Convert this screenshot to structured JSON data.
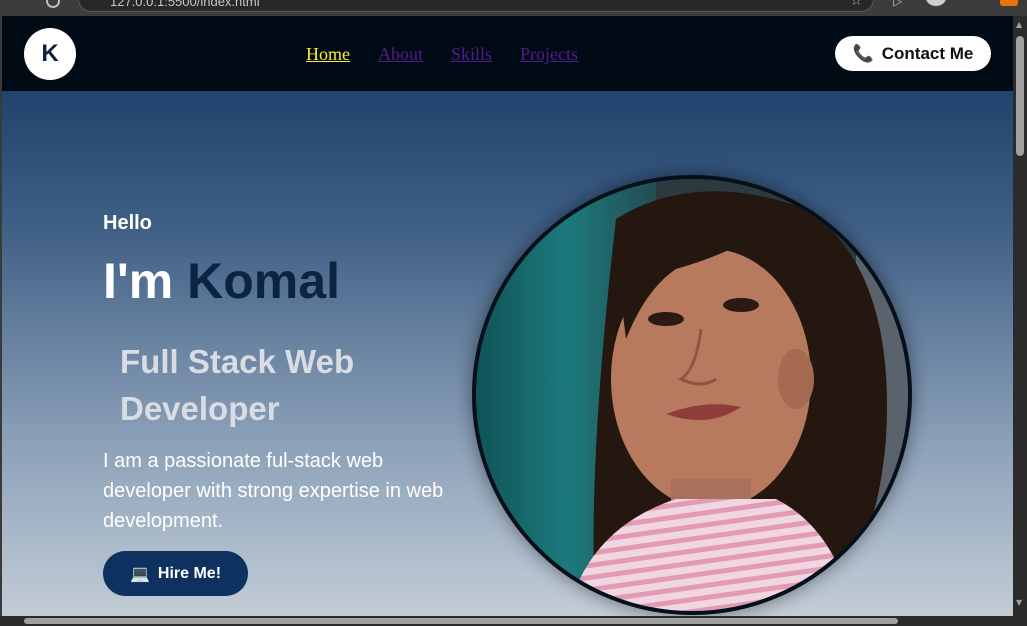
{
  "browser": {
    "url_text": "127.0.0.1:5500/index.html"
  },
  "navbar": {
    "logo_letter": "K",
    "links": [
      {
        "label": "Home",
        "active": true
      },
      {
        "label": "About",
        "active": false
      },
      {
        "label": "Skills",
        "active": false
      },
      {
        "label": "Projects",
        "active": false
      }
    ],
    "contact_label": "Contact Me",
    "contact_icon": "phone-icon"
  },
  "hero": {
    "greeting": "Hello",
    "intro_prefix": "I'm",
    "name": "Komal",
    "role": "Full Stack Web Developer",
    "description": "I am a passionate ful-stack web developer with strong expertise in web development.",
    "hire_label": "Hire Me!",
    "hire_icon": "laptop-icon"
  },
  "colors": {
    "nav_bg": "#010b16",
    "active_link": "#ffeb3b",
    "visited_link": "#551a8b",
    "name_accent": "#0b2440",
    "button_bg": "#0d3260",
    "gradient_top": "#0f3460",
    "gradient_bottom": "#c2ccd6"
  }
}
